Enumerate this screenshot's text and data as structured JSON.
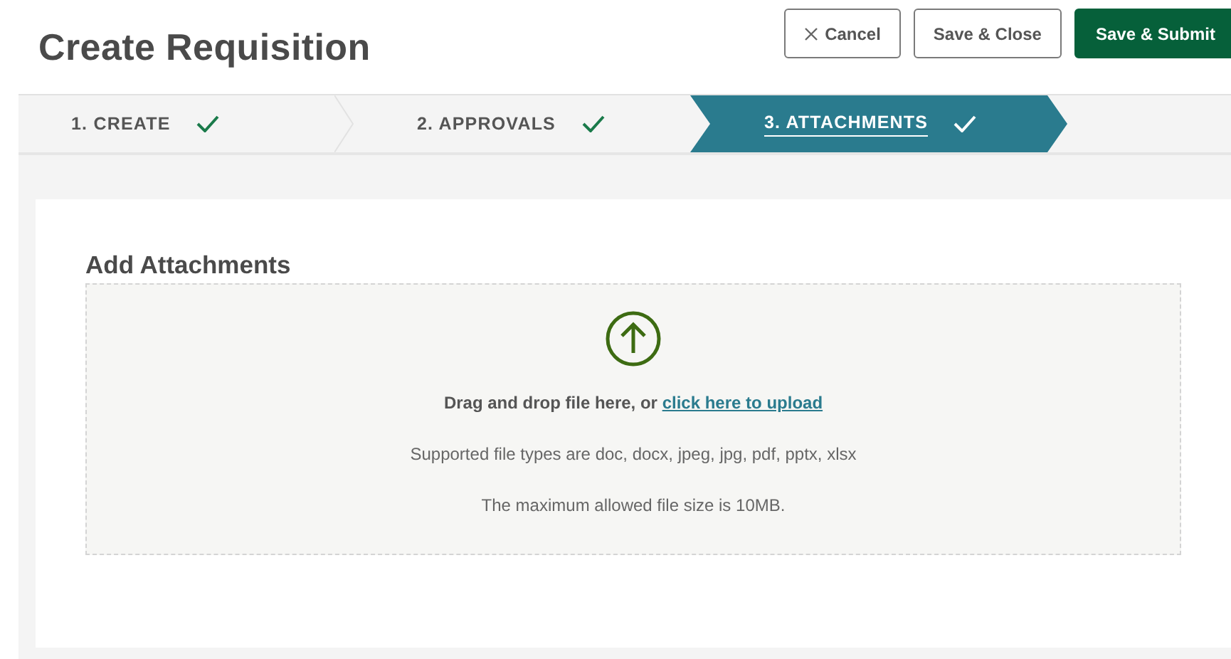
{
  "page": {
    "title": "Create Requisition"
  },
  "actions": [
    {
      "label": "Cancel",
      "kind": "cancel"
    },
    {
      "label": "Save & Close",
      "kind": "secondary"
    },
    {
      "label": "Save & Submit",
      "kind": "primary"
    }
  ],
  "steps": [
    {
      "label": "1. CREATE",
      "completed": true,
      "selected": false
    },
    {
      "label": "2. APPROVALS",
      "completed": true,
      "selected": false
    },
    {
      "label": "3. ATTACHMENTS",
      "completed": true,
      "selected": true
    }
  ],
  "section": {
    "title": "Add Attachments"
  },
  "drop_zone": {
    "instruction": "Drag and drop file here, or",
    "link": "click here to upload",
    "types_note": "Supported file types are doc, docx, jpeg, jpg, pdf, pptx, xlsx",
    "size_note": "The maximum allowed file size is 10MB."
  }
}
